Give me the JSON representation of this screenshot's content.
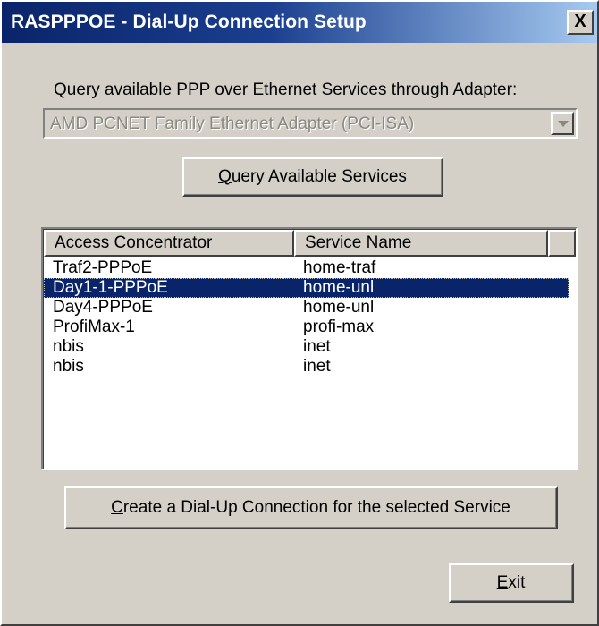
{
  "window": {
    "title": "RASPPPOE - Dial-Up Connection Setup",
    "close_label": "X"
  },
  "adapter": {
    "prompt": "Query available PPP over Ethernet Services through Adapter:",
    "selected": "AMD PCNET Family Ethernet Adapter (PCI-ISA)",
    "disabled": true
  },
  "buttons": {
    "query_prefix": "",
    "query_mnemonic": "Q",
    "query_rest": "uery Available Services",
    "create_mnemonic": "C",
    "create_rest": "reate a Dial-Up Connection for the selected Service",
    "exit_mnemonic": "E",
    "exit_rest": "xit"
  },
  "services_list": {
    "columns": [
      "Access Concentrator",
      "Service Name",
      ""
    ],
    "rows": [
      {
        "access_concentrator": "Traf2-PPPoE",
        "service_name": "home-traf",
        "selected": false
      },
      {
        "access_concentrator": "Day1-1-PPPoE",
        "service_name": "home-unl",
        "selected": true
      },
      {
        "access_concentrator": "Day4-PPPoE",
        "service_name": "home-unl",
        "selected": false
      },
      {
        "access_concentrator": "ProfiMax-1",
        "service_name": "profi-max",
        "selected": false
      },
      {
        "access_concentrator": "nbis",
        "service_name": "inet",
        "selected": false
      },
      {
        "access_concentrator": "nbis",
        "service_name": "inet",
        "selected": false
      }
    ]
  },
  "colors": {
    "face": "#d4d0c8",
    "title_active": "#0a246a",
    "selection": "#0a246a"
  }
}
